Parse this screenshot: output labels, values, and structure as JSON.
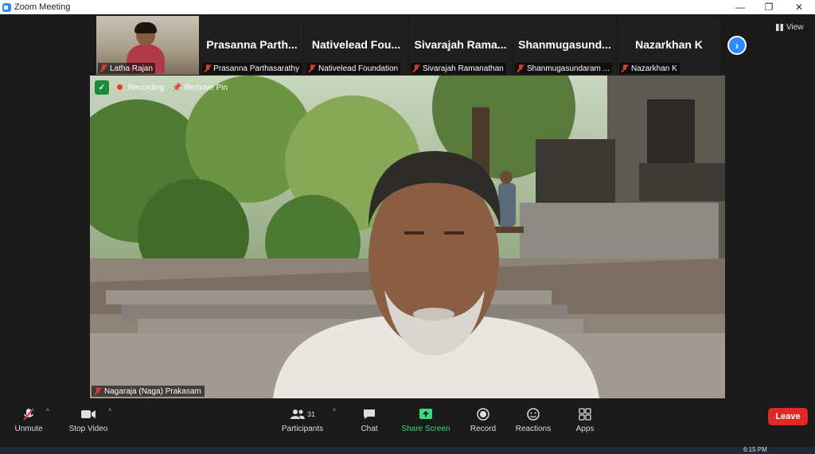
{
  "window": {
    "title": "Zoom Meeting",
    "minimize": "—",
    "restore": "❐",
    "close": "✕"
  },
  "gallery": {
    "tiles": [
      {
        "label": "Latha Rajan",
        "big_name": ""
      },
      {
        "label": "Prasanna Parthasarathy",
        "big_name": "Prasanna Parth..."
      },
      {
        "label": "Nativelead Foundation",
        "big_name": "Nativelead Fou..."
      },
      {
        "label": "Sivarajah Ramanathan",
        "big_name": "Sivarajah Rama..."
      },
      {
        "label": "Shanmugasundaram ...",
        "big_name": "Shanmugasund..."
      },
      {
        "label": "Nazarkhan K",
        "big_name": "Nazarkhan K"
      }
    ],
    "next_icon": "›",
    "view_label": "View"
  },
  "main_video": {
    "recording_label": "Recording",
    "remove_pin_label": "Remove Pin",
    "speaker_name": "Nagaraja (Naga) Prakasam"
  },
  "toolbar": {
    "unmute": "Unmute",
    "stop_video": "Stop Video",
    "participants": "Participants",
    "participants_count": "31",
    "chat": "Chat",
    "share_screen": "Share Screen",
    "record": "Record",
    "reactions": "Reactions",
    "apps": "Apps",
    "leave": "Leave"
  },
  "taskbar": {
    "time": "6:15 PM"
  },
  "colors": {
    "accent": "#2d8cff",
    "share_green": "#3fd77b",
    "leave_red": "#e02828",
    "muted_red": "#e0392b",
    "background": "#1a1a1a"
  }
}
